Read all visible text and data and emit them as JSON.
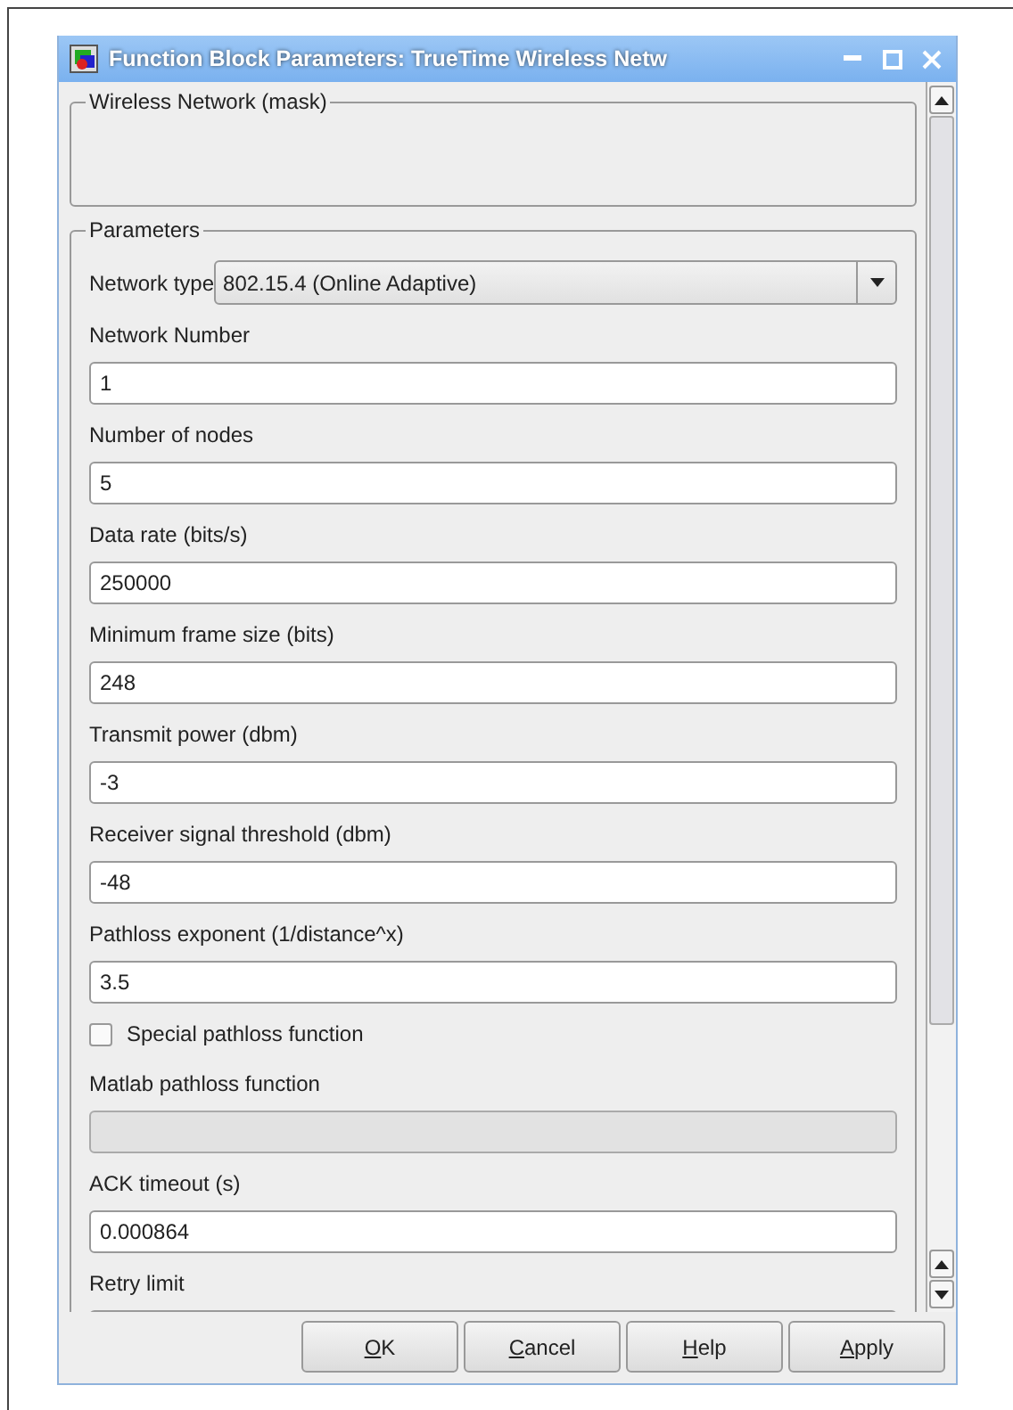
{
  "window": {
    "title": "Function Block Parameters: TrueTime Wireless Netw"
  },
  "mask_group": {
    "title": "Wireless Network (mask)"
  },
  "parameters": {
    "title": "Parameters",
    "items": [
      {
        "kind": "select",
        "label": "Network type",
        "value": "802.15.4 (Online Adaptive)"
      },
      {
        "kind": "field",
        "label": "Network Number",
        "value": "1",
        "disabled": false
      },
      {
        "kind": "field",
        "label": "Number of nodes",
        "value": "5",
        "disabled": false
      },
      {
        "kind": "field",
        "label": "Data rate (bits/s)",
        "value": "250000",
        "disabled": false
      },
      {
        "kind": "field",
        "label": "Minimum frame size (bits)",
        "value": "248",
        "disabled": false
      },
      {
        "kind": "field",
        "label": "Transmit power (dbm)",
        "value": "-3",
        "disabled": false
      },
      {
        "kind": "field",
        "label": "Receiver signal threshold (dbm)",
        "value": "-48",
        "disabled": false
      },
      {
        "kind": "field",
        "label": "Pathloss exponent (1/distance^x)",
        "value": "3.5",
        "disabled": false
      },
      {
        "kind": "checkbox",
        "label": "Special pathloss function",
        "checked": false
      },
      {
        "kind": "field",
        "label": "Matlab pathloss function",
        "disabled": true
      },
      {
        "kind": "field",
        "label": "ACK timeout (s)",
        "value": "0.000864",
        "disabled": false
      },
      {
        "kind": "field",
        "label": "Retry limit"
      }
    ]
  },
  "buttons": [
    "OK",
    "Cancel",
    "Help",
    "Apply"
  ]
}
